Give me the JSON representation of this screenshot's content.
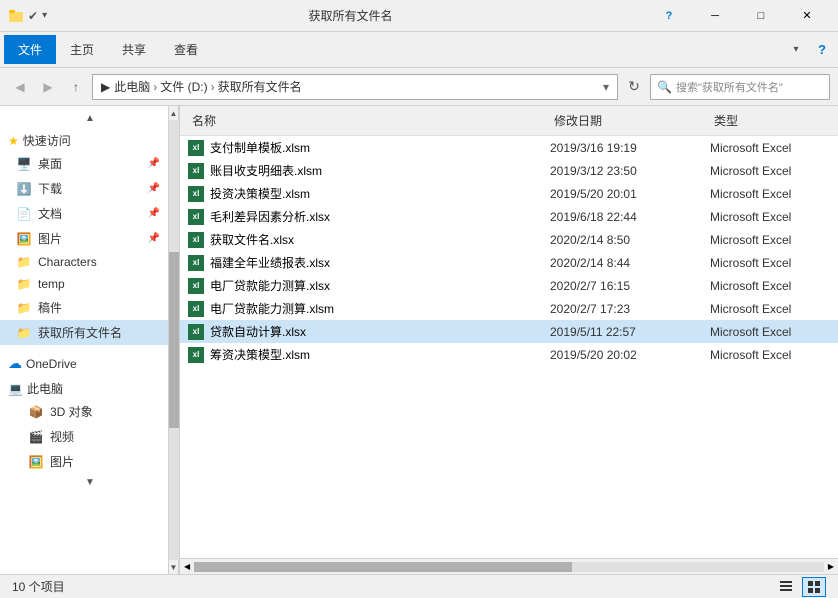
{
  "titleBar": {
    "title": "获取所有文件名",
    "minimizeLabel": "─",
    "maximizeLabel": "□",
    "closeLabel": "✕"
  },
  "ribbon": {
    "tabs": [
      "文件",
      "主页",
      "共享",
      "查看"
    ]
  },
  "addressBar": {
    "path": [
      "此电脑",
      "文件 (D:)",
      "获取所有文件名"
    ],
    "searchPlaceholder": "搜索\"获取所有文件名\""
  },
  "sidebar": {
    "quickAccess": "快速访问",
    "items": [
      {
        "label": "桌面",
        "icon": "🖥️",
        "pinned": true
      },
      {
        "label": "下载",
        "icon": "⬇️",
        "pinned": true
      },
      {
        "label": "文档",
        "icon": "📄",
        "pinned": true
      },
      {
        "label": "图片",
        "icon": "🖼️",
        "pinned": true
      },
      {
        "label": "Characters",
        "icon": "📁",
        "pinned": false
      },
      {
        "label": "temp",
        "icon": "📁",
        "pinned": false
      },
      {
        "label": "稿件",
        "icon": "📁",
        "pinned": false
      },
      {
        "label": "获取所有文件名",
        "icon": "📁",
        "pinned": false,
        "active": true
      }
    ],
    "oneDrive": "OneDrive",
    "thisPC": "此电脑",
    "pcItems": [
      {
        "label": "3D 对象",
        "icon": "📦"
      },
      {
        "label": "视频",
        "icon": "🎬"
      },
      {
        "label": "图片",
        "icon": "🖼️"
      }
    ]
  },
  "fileList": {
    "columns": [
      "名称",
      "修改日期",
      "类型"
    ],
    "files": [
      {
        "name": "支付制单模板.xlsm",
        "date": "2019/3/16 19:19",
        "type": "Microsoft Excel",
        "selected": false
      },
      {
        "name": "账目收支明细表.xlsm",
        "date": "2019/3/12 23:50",
        "type": "Microsoft Excel",
        "selected": false
      },
      {
        "name": "投资决策模型.xlsm",
        "date": "2019/5/20 20:01",
        "type": "Microsoft Excel",
        "selected": false
      },
      {
        "name": "毛利差异因素分析.xlsx",
        "date": "2019/6/18 22:44",
        "type": "Microsoft Excel",
        "selected": false
      },
      {
        "name": "获取文件名.xlsx",
        "date": "2020/2/14 8:50",
        "type": "Microsoft Excel",
        "selected": false
      },
      {
        "name": "福建全年业绩报表.xlsx",
        "date": "2020/2/14 8:44",
        "type": "Microsoft Excel",
        "selected": false
      },
      {
        "name": "电厂贷款能力测算.xlsx",
        "date": "2020/2/7 16:15",
        "type": "Microsoft Excel",
        "selected": false
      },
      {
        "name": "电厂贷款能力测算.xlsm",
        "date": "2020/2/7 17:23",
        "type": "Microsoft Excel",
        "selected": false
      },
      {
        "name": "贷款自动计算.xlsx",
        "date": "2019/5/11 22:57",
        "type": "Microsoft Excel",
        "selected": true
      },
      {
        "name": "筹资决策模型.xlsm",
        "date": "2019/5/20 20:02",
        "type": "Microsoft Excel",
        "selected": false
      }
    ]
  },
  "statusBar": {
    "itemCount": "10 个项目"
  }
}
